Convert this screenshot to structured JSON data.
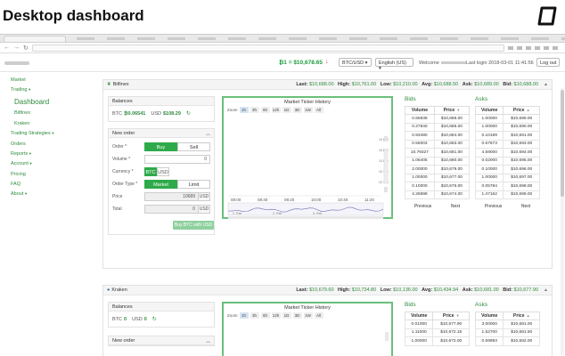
{
  "slide_title": "Desktop dashboard",
  "topbar": {
    "btc_price": "₿1 = $10,678.65",
    "currency_select": "BTC/USD",
    "language_select": "English (US)",
    "welcome": "Welcome",
    "last_login": "Last login 2018-03-01 11:41:56",
    "logout": "Log out"
  },
  "sidebar": {
    "items": [
      {
        "label": "Market"
      },
      {
        "label": "Trading",
        "caret": "▾"
      },
      {
        "label": "Dashboard"
      },
      {
        "label": "Bitfinex"
      },
      {
        "label": "Kraken"
      },
      {
        "label": "Trading Strategies",
        "caret": "▾"
      },
      {
        "label": "Orders"
      },
      {
        "label": "Reports",
        "caret": "▾"
      },
      {
        "label": "Account",
        "caret": "▾"
      },
      {
        "label": "Pricing"
      },
      {
        "label": "FAQ"
      },
      {
        "label": "About",
        "caret": "▾"
      }
    ]
  },
  "colors": {
    "accent": "#2e8b3d",
    "button_green": "#2eaa4a",
    "chart_line": "#6f6fb5",
    "price_down": "#dd4433"
  },
  "stat_labels": {
    "last": "Last:",
    "high": "High:",
    "low": "Low:",
    "avg": "Avg:",
    "ask": "Ask:",
    "bid": "Bid:"
  },
  "exchanges": [
    {
      "name": "Bitfinex",
      "stats": {
        "last": "$10,688.00",
        "high": "$10,761.00",
        "low": "$10,210.00",
        "avg": "$10,688.50",
        "ask": "$10,689.00",
        "bid": "$10,688.00"
      },
      "balances": {
        "title": "Balances",
        "btc_label": "BTC",
        "btc": "₿0.06541",
        "usd_label": "USD",
        "usd": "$108.29"
      },
      "order": {
        "title": "New order",
        "order_label": "Order *",
        "buy": "Buy",
        "sell": "Sell",
        "volume_label": "Volume *",
        "volume": "0",
        "currency_label": "Currency *",
        "cur_btc": "BTC",
        "cur_usd": "USD",
        "type_label": "Order Type *",
        "market": "Market",
        "limit": "Limit",
        "price_label": "Price",
        "price": "10689",
        "price_unit": "USD",
        "total_label": "Total",
        "total": "0",
        "total_unit": "USD",
        "submit": "Buy BTC with USD"
      },
      "chart": {
        "title": "Market Ticker History",
        "zoom_label": "Zoom",
        "zoom_buttons": [
          "1h",
          "3h",
          "6h",
          "12h",
          "1D",
          "3D",
          "1W",
          "All"
        ],
        "x_ticks": [
          "08:00",
          "08:40",
          "09:20",
          "10:00",
          "10:40",
          "11:20"
        ],
        "nav_labels": [
          "1. Feb",
          "2. Feb",
          "3. Feb"
        ],
        "y_ticks": [
          "10 880",
          "10 840",
          "10 800",
          "10 760",
          "10 720"
        ]
      },
      "bids": {
        "title": "Bids",
        "col_volume": "Volume",
        "col_price": "Price",
        "rows": [
          [
            "0.55838",
            "$10,686.00"
          ],
          [
            "0.27840",
            "$10,685.00"
          ],
          [
            "0.93480",
            "$10,684.00"
          ],
          [
            "0.55003",
            "$10,683.00"
          ],
          [
            "10.79327",
            "$10,681.00"
          ],
          [
            "1.06405",
            "$10,680.00"
          ],
          [
            "2.00000",
            "$10,679.00"
          ],
          [
            "1.00000",
            "$10,677.00"
          ],
          [
            "0.10000",
            "$10,676.00"
          ],
          [
            "4.26698",
            "$10,674.00"
          ]
        ],
        "prev": "Previous",
        "next": "Next"
      },
      "asks": {
        "title": "Asks",
        "col_volume": "Volume",
        "col_price": "Price",
        "rows": [
          [
            "1.00000",
            "$10,689.00"
          ],
          [
            "1.00000",
            "$10,690.00"
          ],
          [
            "0.10189",
            "$10,691.00"
          ],
          [
            "0.67673",
            "$10,693.00"
          ],
          [
            "4.59000",
            "$10,694.00"
          ],
          [
            "0.02000",
            "$10,695.00"
          ],
          [
            "0.10000",
            "$10,696.00"
          ],
          [
            "1.00000",
            "$10,697.00"
          ],
          [
            "0.05784",
            "$10,698.00"
          ],
          [
            "1.47162",
            "$10,699.00"
          ]
        ],
        "prev": "Previous",
        "next": "Next"
      }
    },
    {
      "name": "Kraken",
      "stats": {
        "last": "$10,679.60",
        "high": "$10,734.80",
        "low": "$10,136.00",
        "avg": "$10,434.94",
        "ask": "$10,681.00",
        "bid": "$10,677.90"
      },
      "balances": {
        "title": "Balances",
        "btc_label": "BTC",
        "btc": "0",
        "usd_label": "USD",
        "usd": "0"
      },
      "order": {
        "title": "New order"
      },
      "chart": {
        "title": "Market Ticker History",
        "zoom_label": "Zoom",
        "zoom_buttons": [
          "1h",
          "3h",
          "6h",
          "12h",
          "1D",
          "3D",
          "1W",
          "All"
        ]
      },
      "bids": {
        "title": "Bids",
        "col_volume": "Volume",
        "col_price": "Price",
        "rows": [
          [
            "0.01000",
            "$10,677.90"
          ],
          [
            "1.11000",
            "$10,672.15"
          ],
          [
            "1.00000",
            "$10,672.00"
          ]
        ]
      },
      "asks": {
        "title": "Asks",
        "col_volume": "Volume",
        "col_price": "Price",
        "rows": [
          [
            "3.00000",
            "$10,681.00"
          ],
          [
            "1.52700",
            "$10,681.50"
          ],
          [
            "0.59993",
            "$10,682.00"
          ]
        ]
      }
    }
  ]
}
